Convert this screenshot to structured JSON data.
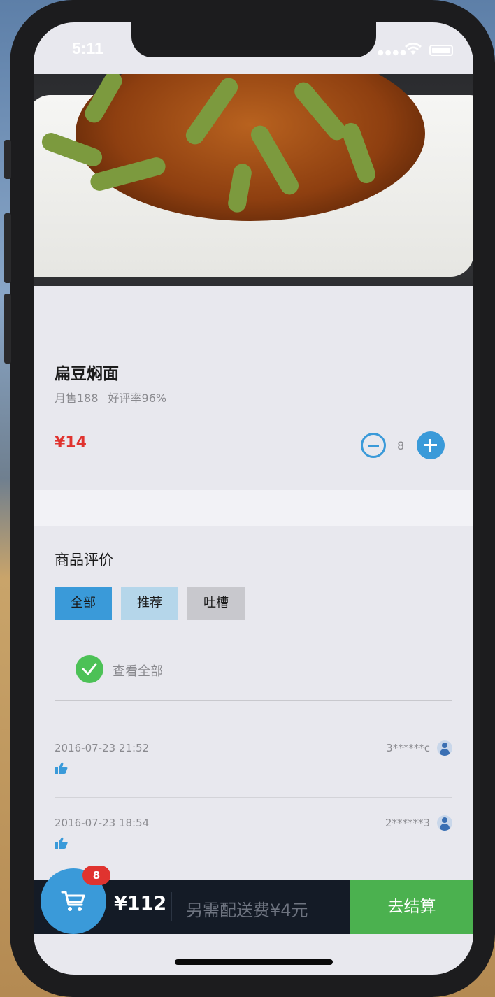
{
  "status_bar": {
    "time": "5:11"
  },
  "product": {
    "name": "扁豆焖面",
    "monthly_sales": "月售188",
    "rating": "好评率96%",
    "price": "¥14",
    "quantity": "8"
  },
  "reviews": {
    "title": "商品评价",
    "tabs": [
      {
        "label": "全部",
        "selected": true
      },
      {
        "label": "推荐",
        "selected": false
      },
      {
        "label": "吐槽",
        "selected": false
      }
    ],
    "view_all_label": "查看全部",
    "items": [
      {
        "time": "2016-07-23 21:52",
        "user": "3******c",
        "icon": "thumb-up-icon"
      },
      {
        "time": "2016-07-23 18:54",
        "user": "2******3",
        "icon": "thumb-up-icon"
      }
    ]
  },
  "cart": {
    "badge_count": "8",
    "total": "¥112",
    "delivery_note": "另需配送费¥4元",
    "checkout_label": "去结算"
  },
  "colors": {
    "accent": "#3a9ad9",
    "price_red": "#e0332f",
    "checkout_green": "#4bb14f",
    "cart_bar": "#141b26"
  }
}
